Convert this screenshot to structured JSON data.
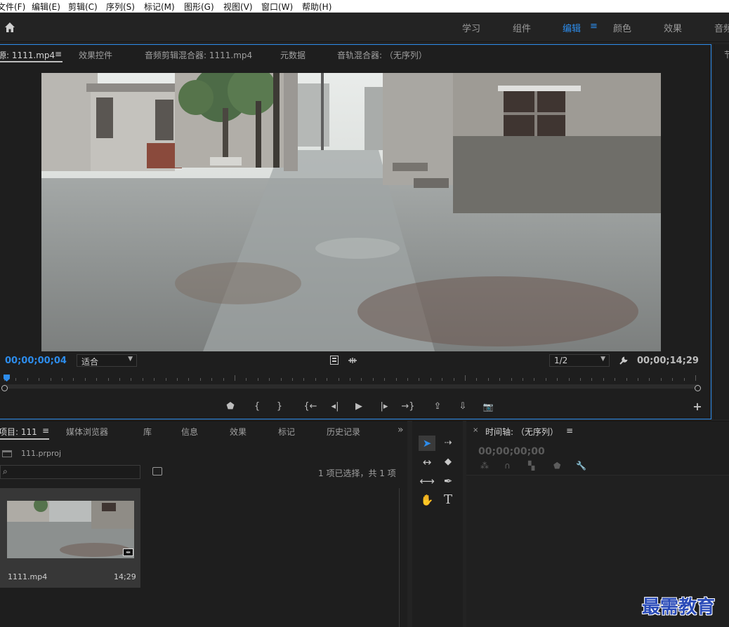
{
  "menu": [
    {
      "label": "文件(F)"
    },
    {
      "label": "编辑(E)"
    },
    {
      "label": "剪辑(C)"
    },
    {
      "label": "序列(S)"
    },
    {
      "label": "标记(M)"
    },
    {
      "label": "图形(G)"
    },
    {
      "label": "视图(V)"
    },
    {
      "label": "窗口(W)"
    },
    {
      "label": "帮助(H)"
    }
  ],
  "workspaces": [
    {
      "label": "学习"
    },
    {
      "label": "组件"
    },
    {
      "label": "编辑",
      "active": true
    },
    {
      "label": "颜色"
    },
    {
      "label": "效果"
    },
    {
      "label": "音频"
    }
  ],
  "workspace_menu": "≡",
  "source_panel": {
    "tabs": [
      {
        "label": "源: 1111.mp4",
        "active": true
      },
      {
        "label": "≡"
      },
      {
        "label": "效果控件"
      },
      {
        "label": "音频剪辑混合器: 1111.mp4"
      },
      {
        "label": "元数据"
      },
      {
        "label": "音轨混合器: （无序列）"
      }
    ],
    "timecode_current": "00;00;00;04",
    "fit_label": "适合",
    "resolution_label": "1/2",
    "timecode_duration": "00;00;14;29",
    "controls": [
      "⬟",
      "{",
      "}",
      "{←",
      "◂|",
      "▶",
      "|▸",
      "→}",
      "⇪",
      "⇩",
      "📷",
      "+"
    ]
  },
  "right_panel_label": "节",
  "project_panel": {
    "tabs": [
      {
        "label": "项目: 111",
        "active": true
      },
      {
        "label": "≡"
      },
      {
        "label": "媒体浏览器"
      },
      {
        "label": "库"
      },
      {
        "label": "信息"
      },
      {
        "label": "效果"
      },
      {
        "label": "标记"
      },
      {
        "label": "历史记录"
      },
      {
        "label": "»"
      }
    ],
    "project_file": "111.prproj",
    "search_placeholder": "",
    "selection_info": "1 项已选择，共 1 项",
    "clip": {
      "name": "1111.mp4",
      "duration": "14;29"
    }
  },
  "tools": [
    {
      "name": "selection-tool",
      "glyph": "➤",
      "active": true
    },
    {
      "name": "track-select-tool",
      "glyph": "⇢"
    },
    {
      "name": "ripple-edit-tool",
      "glyph": "↔"
    },
    {
      "name": "razor-tool",
      "glyph": "◆"
    },
    {
      "name": "slip-tool",
      "glyph": "⟷"
    },
    {
      "name": "pen-tool",
      "glyph": "✒"
    },
    {
      "name": "hand-tool",
      "glyph": "✋"
    },
    {
      "name": "type-tool",
      "glyph": "T"
    }
  ],
  "timeline_panel": {
    "close": "×",
    "title": "时间轴: （无序列）",
    "menu": "≡",
    "timecode": "00;00;00;00"
  },
  "watermark": "最需教育",
  "colors": {
    "accent": "#2d8ceb",
    "panel": "#1e1e1e",
    "chrome": "#232323"
  }
}
